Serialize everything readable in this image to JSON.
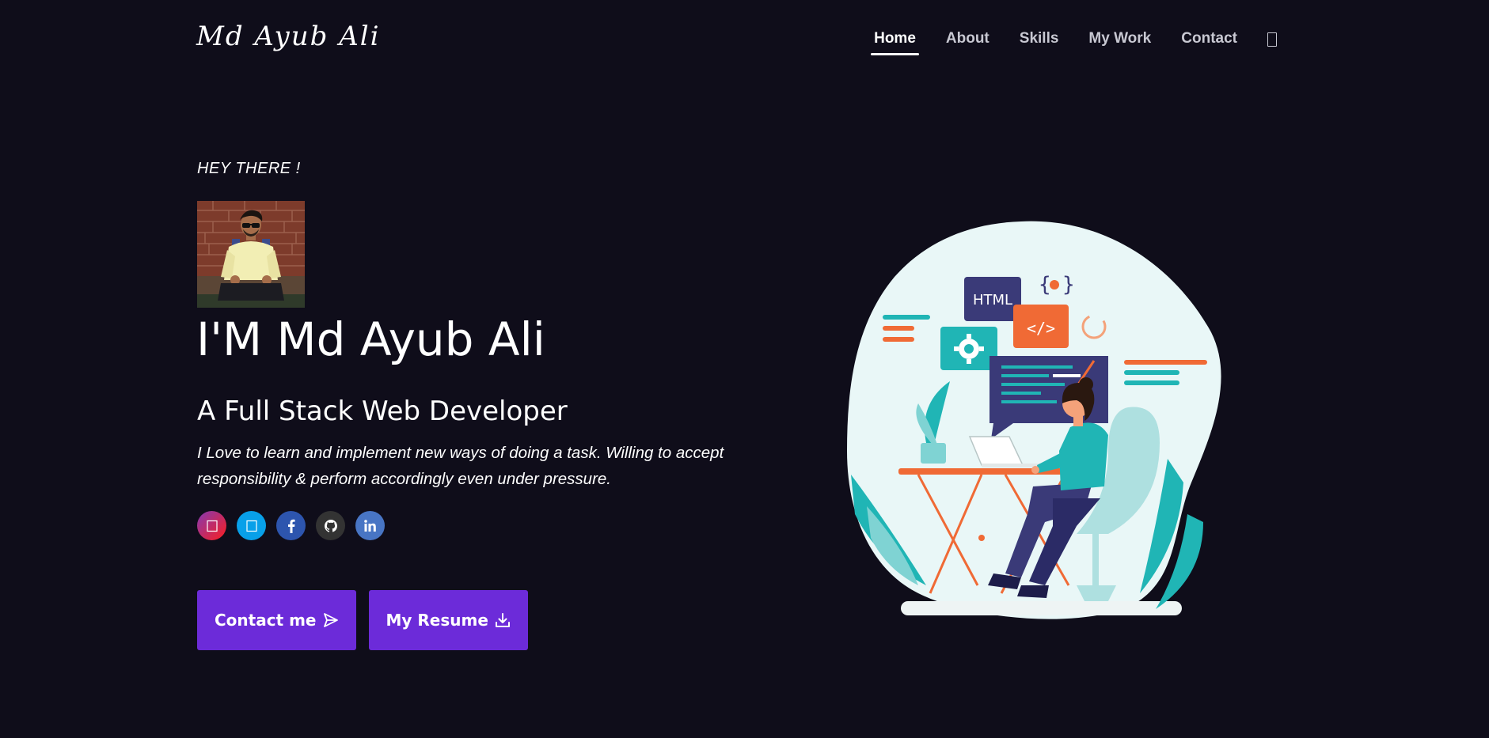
{
  "header": {
    "logo": "Md Ayub Ali",
    "nav": [
      {
        "label": "Home",
        "active": true
      },
      {
        "label": "About",
        "active": false
      },
      {
        "label": "Skills",
        "active": false
      },
      {
        "label": "My Work",
        "active": false
      },
      {
        "label": "Contact",
        "active": false
      }
    ],
    "theme_toggle_icon": "theme-toggle-icon"
  },
  "hero": {
    "greeting": "HEY THERE !",
    "headline": "I'M Md Ayub Ali",
    "subheadline": "A Full Stack Web Developer",
    "description": "I Love to learn and implement new ways of doing a task. Willing to accept responsibility & perform accordingly even under pressure.",
    "socials": [
      {
        "name": "instagram-icon",
        "color": "#d62976"
      },
      {
        "name": "twitter-icon",
        "color": "#08a0e9"
      },
      {
        "name": "facebook-icon",
        "color": "#3b5998"
      },
      {
        "name": "github-icon",
        "color": "#333333"
      },
      {
        "name": "linkedin-icon",
        "color": "#4875b4"
      }
    ],
    "buttons": {
      "contact_label": "Contact me",
      "resume_label": "My Resume"
    },
    "illustration_text": "HTML"
  },
  "colors": {
    "background": "#0f0d1a",
    "accent": "#6c2bd9"
  }
}
